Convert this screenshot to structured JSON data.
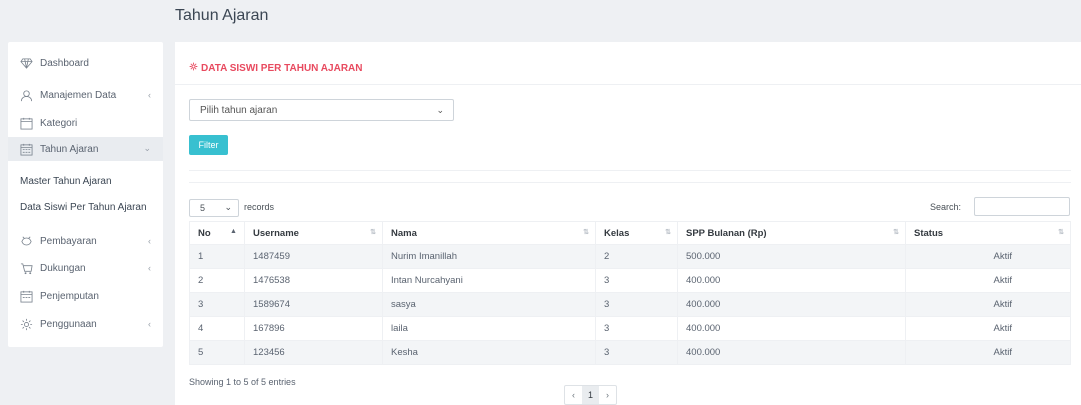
{
  "header": {
    "title": "Tahun Ajaran"
  },
  "sidebar": {
    "items": [
      {
        "label": "Dashboard",
        "icon": "diamond-icon"
      },
      {
        "label": "Manajemen Data",
        "icon": "user-icon",
        "chevron": "‹"
      },
      {
        "label": "Kategori",
        "icon": "calendar-icon"
      },
      {
        "label": "Tahun Ajaran",
        "icon": "calendar-grid-icon",
        "chevron": "⌄"
      },
      {
        "label": "Pembayaran",
        "icon": "wallet-icon",
        "chevron": "‹"
      },
      {
        "label": "Dukungan",
        "icon": "cart-icon",
        "chevron": "‹"
      },
      {
        "label": "Penjemputan",
        "icon": "calendar-grid-icon"
      },
      {
        "label": "Penggunaan",
        "icon": "gear-icon",
        "chevron": "‹"
      }
    ],
    "sub_items": [
      "Master Tahun Ajaran",
      "Data Siswi Per Tahun Ajaran"
    ]
  },
  "card": {
    "title": "DATA SISWI PER TAHUN AJARAN",
    "select_value": "Pilih tahun ajaran",
    "filter_label": "Filter"
  },
  "table": {
    "length_value": "5",
    "length_label": "records",
    "search_label": "Search:",
    "columns": [
      "No",
      "Username",
      "Nama",
      "Kelas",
      "SPP Bulanan (Rp)",
      "Status"
    ],
    "rows": [
      [
        "1",
        "1487459",
        "Nurim Imanillah",
        "2",
        "500.000",
        "Aktif"
      ],
      [
        "2",
        "1476538",
        "Intan Nurcahyani",
        "3",
        "400.000",
        "Aktif"
      ],
      [
        "3",
        "1589674",
        "sasya",
        "3",
        "400.000",
        "Aktif"
      ],
      [
        "4",
        "167896",
        "laila",
        "3",
        "400.000",
        "Aktif"
      ],
      [
        "5",
        "123456",
        "Kesha",
        "3",
        "400.000",
        "Aktif"
      ]
    ],
    "info": "Showing 1 to 5 of 5 entries",
    "pager": {
      "prev": "‹",
      "current": "1",
      "next": "›"
    }
  },
  "colors": {
    "accent": "#38c0d0",
    "title_red": "#e84a5f"
  }
}
